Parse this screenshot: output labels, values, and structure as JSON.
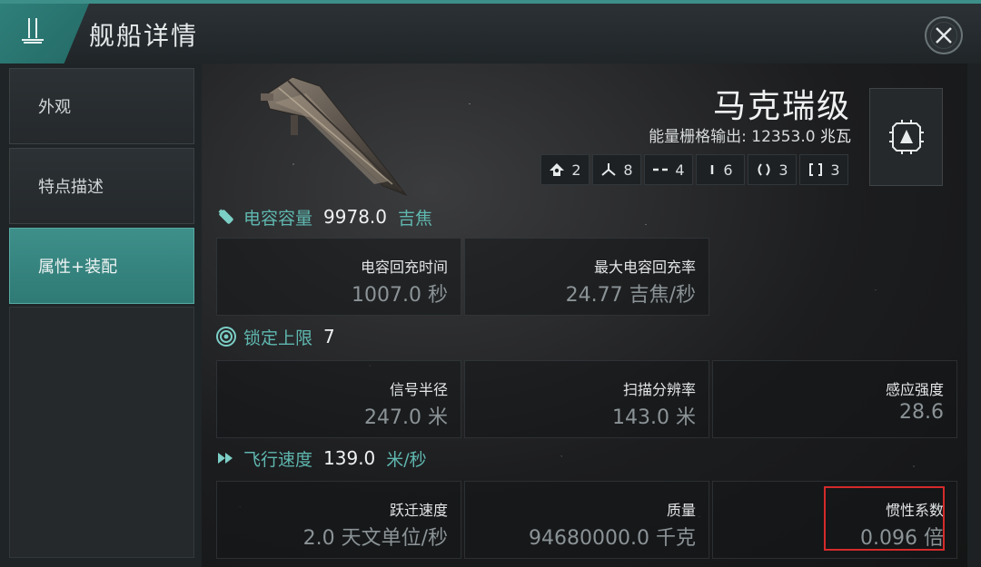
{
  "window": {
    "title": "舰船详情",
    "close_icon": "close-icon",
    "logo_icon": "ship-silhouette-icon"
  },
  "sidebar": {
    "items": [
      {
        "label": "外观",
        "active": false
      },
      {
        "label": "特点描述",
        "active": false
      },
      {
        "label": "属性+装配",
        "active": true
      }
    ]
  },
  "ship": {
    "name": "马克瑞级",
    "grid_label": "能量栅格输出:",
    "grid_value": "12353.0",
    "grid_unit": "兆瓦",
    "badge_icon": "ship-class-icon"
  },
  "slots": [
    {
      "icon": "high-slot-icon",
      "count": "2"
    },
    {
      "icon": "turret-icon",
      "count": "8"
    },
    {
      "icon": "mid-slot-icon",
      "count": "4"
    },
    {
      "icon": "low-slot-icon",
      "count": "6"
    },
    {
      "icon": "rig-icon",
      "count": "3"
    },
    {
      "icon": "subsystem-icon",
      "count": "3"
    }
  ],
  "sections": {
    "capacitor": {
      "label": "电容容量",
      "value": "9978.0",
      "unit": "吉焦",
      "cells": [
        {
          "label": "电容回充时间",
          "value": "1007.0 秒"
        },
        {
          "label": "最大电容回充率",
          "value": "24.77 吉焦/秒"
        }
      ]
    },
    "targeting": {
      "label": "锁定上限",
      "value": "7",
      "cells": [
        {
          "label": "信号半径",
          "value": "247.0 米"
        },
        {
          "label": "扫描分辨率",
          "value": "143.0 米"
        },
        {
          "label": "感应强度",
          "value": "28.6"
        }
      ]
    },
    "navigation": {
      "label": "飞行速度",
      "value": "139.0",
      "unit": "米/秒",
      "cells": [
        {
          "label": "跃迁速度",
          "value": "2.0 天文单位/秒"
        },
        {
          "label": "质量",
          "value": "94680000.0 千克"
        },
        {
          "label": "惯性系数",
          "value": "0.096 倍"
        }
      ]
    }
  },
  "colors": {
    "accent": "#3d8f8a",
    "section_label": "#5fb8b0",
    "highlight_border": "#d42a2a"
  }
}
